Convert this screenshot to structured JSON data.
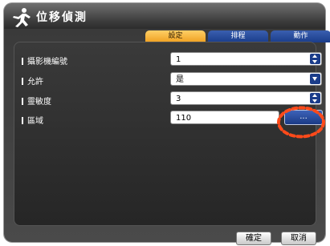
{
  "window": {
    "title": "位移偵測"
  },
  "tabs": [
    {
      "label": "設定",
      "active": true
    },
    {
      "label": "排程",
      "active": false
    },
    {
      "label": "動作",
      "active": false
    }
  ],
  "rows": {
    "camera_number": {
      "label": "攝影機編號",
      "value": "1"
    },
    "enable": {
      "label": "允許",
      "value": "是"
    },
    "sensitivity": {
      "label": "靈敏度",
      "value": "3"
    },
    "region": {
      "label": "區域",
      "value": "110",
      "button_label": "..."
    }
  },
  "footer": {
    "ok_label": "確定",
    "cancel_label": "取消"
  },
  "colors": {
    "active_tab": "#f0a020",
    "inactive_tab": "#1b3d8a",
    "highlight_ring": "#ff4a1a"
  },
  "icons": {
    "title": "running-person-icon"
  }
}
